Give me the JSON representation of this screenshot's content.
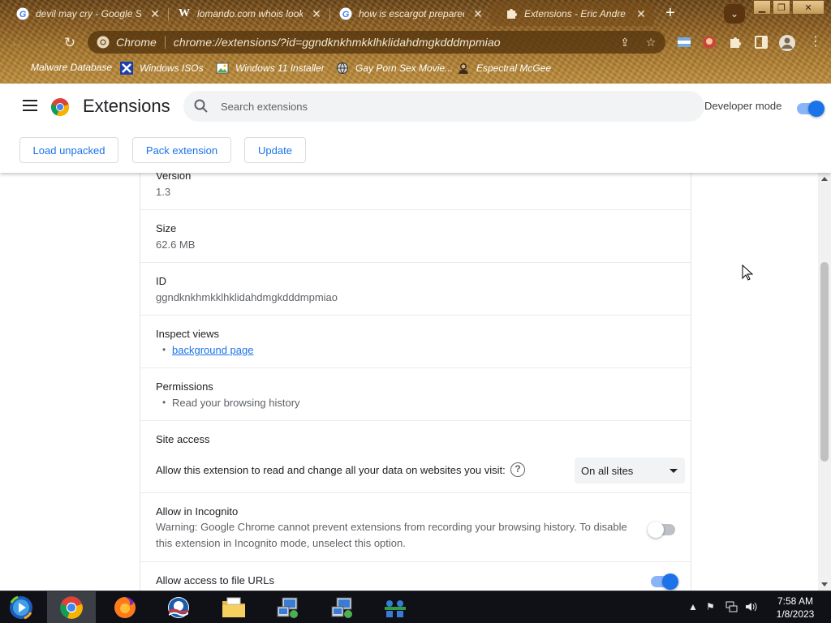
{
  "browser": {
    "tabs": [
      {
        "title": "devil may cry - Google Se",
        "favicon": "google-g-icon"
      },
      {
        "title": "lomando.com whois lookup",
        "favicon": "wikipedia-w-icon"
      },
      {
        "title": "how is escargot prepared",
        "favicon": "google-g-icon"
      },
      {
        "title": "Extensions - Eric Andre",
        "favicon": "puzzle-piece-icon",
        "active": true
      }
    ],
    "omnibox": {
      "site_label": "Chrome",
      "url": "chrome://extensions/?id=ggndknkhmkklhklidahdmgkdddmpmiao"
    },
    "bookmarks": [
      {
        "label": "Malware Database",
        "icon": "none"
      },
      {
        "label": "Windows ISOs",
        "icon": "x-logo-icon"
      },
      {
        "label": "Windows 11 Installer",
        "icon": "image-file-icon"
      },
      {
        "label": "Gay Porn Sex Movie...",
        "icon": "globe-icon"
      },
      {
        "label": "Espectral McGee",
        "icon": "avatar-icon"
      }
    ],
    "colors": {
      "theme": "#8a5c22",
      "omnibox": "#55340e"
    }
  },
  "header": {
    "title": "Extensions",
    "search_placeholder": "Search extensions",
    "developer_mode_label": "Developer mode",
    "developer_mode_on": true,
    "buttons": {
      "load_unpacked": "Load unpacked",
      "pack_extension": "Pack extension",
      "update": "Update"
    }
  },
  "details": {
    "version": {
      "label": "Version",
      "value": "1.3"
    },
    "size": {
      "label": "Size",
      "value": "62.6 MB"
    },
    "id": {
      "label": "ID",
      "value": "ggndknkhmkklhklidahdmgkdddmpmiao"
    },
    "inspect_views": {
      "label": "Inspect views",
      "link": "background page"
    },
    "permissions": {
      "label": "Permissions",
      "item": "Read your browsing history"
    },
    "site_access": {
      "label": "Site access",
      "text": "Allow this extension to read and change all your data on websites you visit:",
      "selected": "On all sites"
    },
    "incognito": {
      "label": "Allow in Incognito",
      "warning": "Warning: Google Chrome cannot prevent extensions from recording your browsing history. To disable this extension in Incognito mode, unselect this option.",
      "enabled": false
    },
    "file_urls": {
      "label": "Allow access to file URLs",
      "enabled": true
    }
  },
  "taskbar": {
    "items": [
      "media-center-icon",
      "chrome-icon",
      "firefox-icon",
      "obama-logo-icon",
      "file-explorer-icon",
      "network-setup-icon",
      "network-setup-icon",
      "network-users-icon"
    ],
    "clock_time": "7:58 AM",
    "clock_date": "1/8/2023"
  }
}
